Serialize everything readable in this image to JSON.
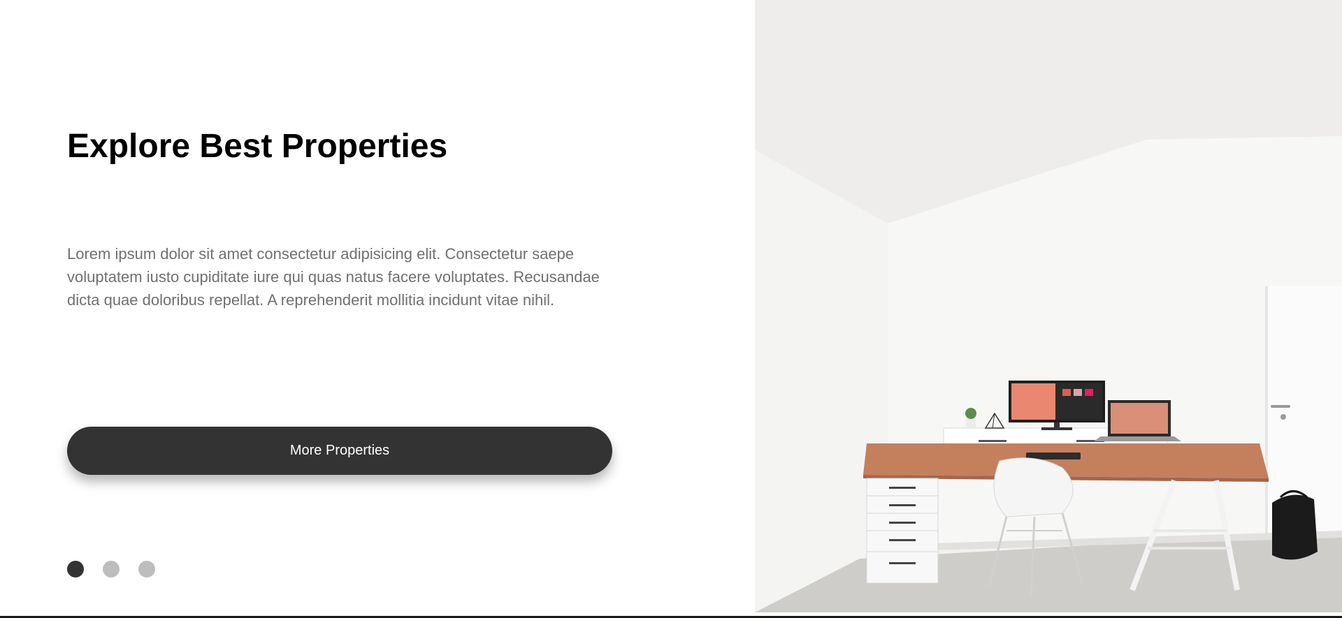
{
  "hero": {
    "title": "Explore Best Properties",
    "description": "Lorem ipsum dolor sit amet consectetur adipisicing elit. Consectetur saepe voluptatem iusto cupiditate iure qui quas natus facere voluptates. Recusandae dicta quae doloribus repellat. A reprehenderit mollitia incidunt vitae nihil.",
    "button_label": "More Properties"
  },
  "slider": {
    "total": 3,
    "active_index": 0
  },
  "image": {
    "subject": "home office interior with desk, monitor, laptop, chair and drawers"
  },
  "colors": {
    "button_bg": "#333333",
    "text_muted": "#707070",
    "dot_active": "#333333",
    "dot_inactive": "#bdbdbd"
  }
}
